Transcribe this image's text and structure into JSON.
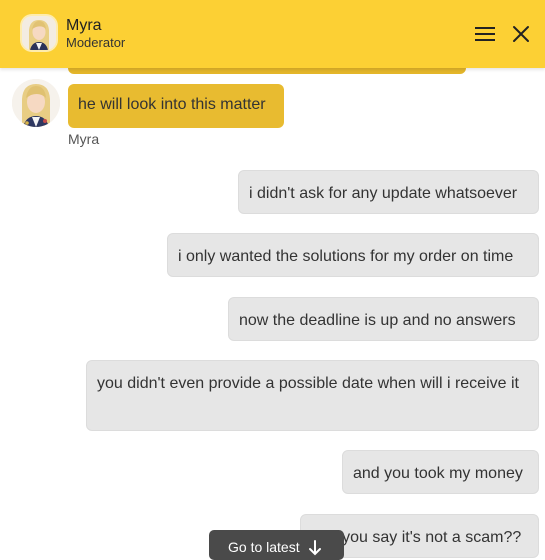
{
  "header": {
    "name": "Myra",
    "role": "Moderator",
    "menu_icon": "hamburger-menu-icon",
    "close_icon": "close-icon",
    "bg_color": "#fcd034"
  },
  "agent_message": {
    "text": "he will look into this matter",
    "sender": "Myra",
    "bubble_color": "#e8bb30"
  },
  "user_messages": [
    "i didn't ask for any update whatsoever",
    "i only wanted the solutions for my order on time",
    "now the deadline is up and no answers",
    "you didn't even provide a possible date when will i receive it",
    "and you took my money",
    "and you say it's not a scam??"
  ],
  "go_to_latest": {
    "label": "Go to latest",
    "icon": "arrow-down-icon"
  }
}
